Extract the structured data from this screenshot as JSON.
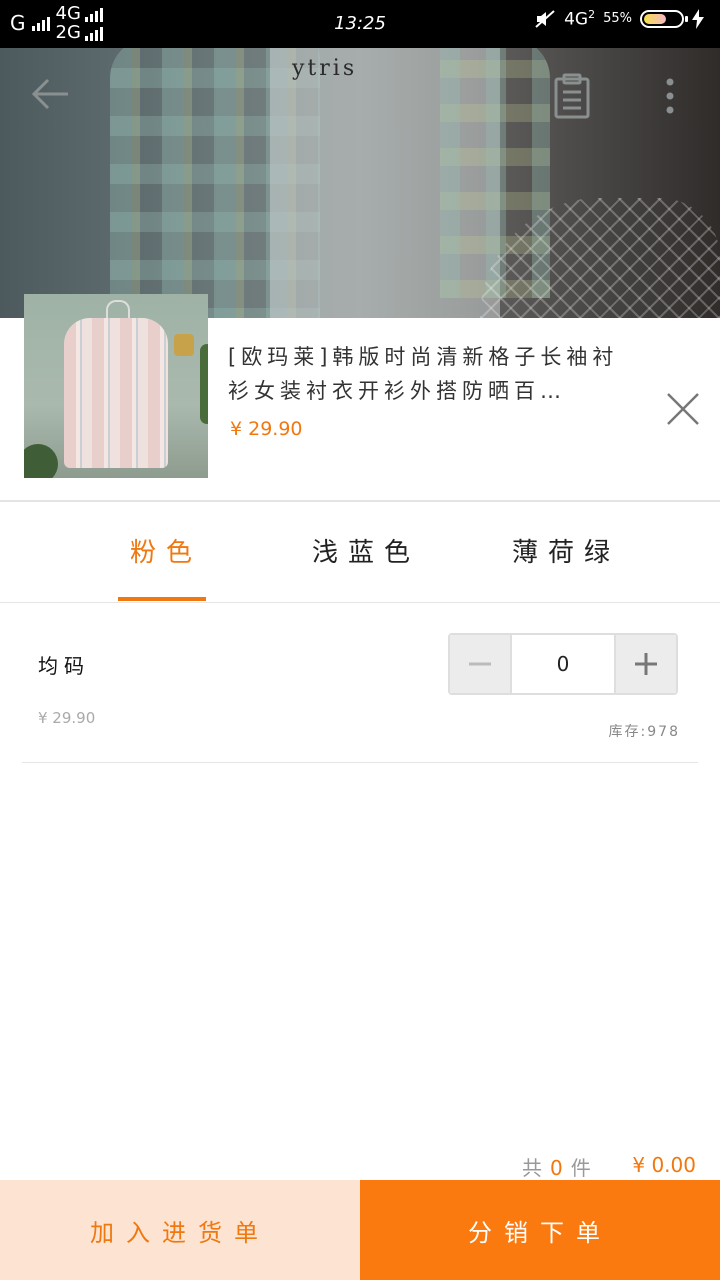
{
  "status_bar": {
    "carrier": "G",
    "network_1": "4G",
    "network_2": "2G",
    "time": "13:25",
    "data_network": "4G",
    "data_sim": "2",
    "battery": "55%"
  },
  "hero": {
    "shirt_print": "ytris"
  },
  "product": {
    "title": "[欧玛莱]韩版时尚清新格子长袖衬衫女装衬衣开衫外搭防晒百…",
    "price": "¥ 29.90"
  },
  "tabs": [
    {
      "label": "粉色",
      "active": true
    },
    {
      "label": "浅蓝色",
      "active": false
    },
    {
      "label": "薄荷绿",
      "active": false
    }
  ],
  "sku": {
    "name": "均码",
    "price": "¥ 29.90",
    "quantity": "0",
    "stock": "库存:978"
  },
  "summary": {
    "count_prefix": "共",
    "count": "0",
    "count_suffix": "件",
    "total": "¥ 0.00"
  },
  "actions": {
    "add_to_cart": "加入进货单",
    "distribute_order": "分销下单"
  },
  "colors": {
    "accent": "#f07810",
    "cart_bg": "#fde4d2",
    "order_bg": "#fa7a10"
  },
  "icons": [
    "back-arrow-icon",
    "clipboard-icon",
    "more-vertical-icon",
    "close-icon",
    "minus-icon",
    "plus-icon"
  ]
}
